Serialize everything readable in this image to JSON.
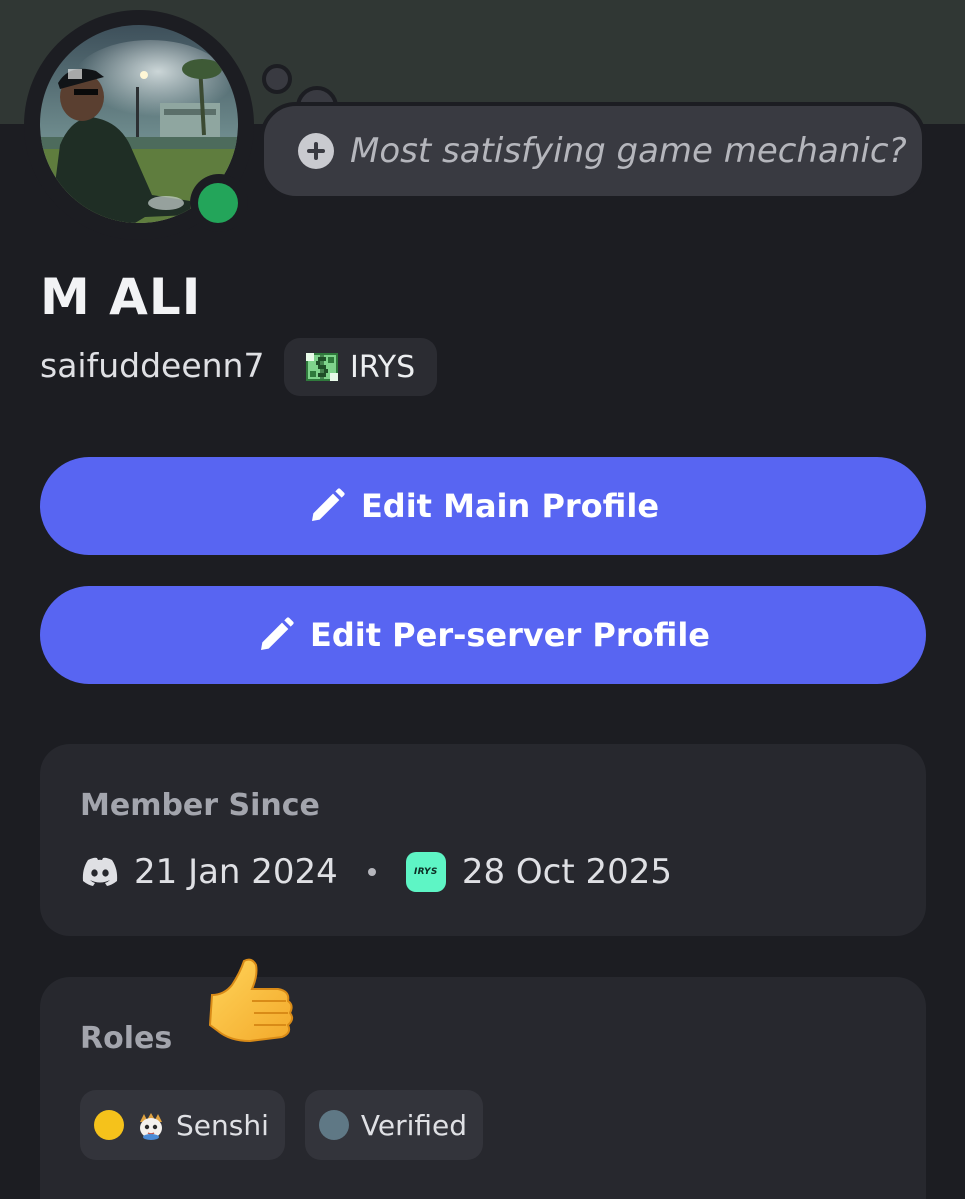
{
  "profile": {
    "display_name": "M ALI",
    "username": "saifuddeenn7",
    "server_tag": "IRYS",
    "status_prompt": "Most satisfying game mechanic?",
    "status_color": "#23a55a",
    "banner_color": "#303734"
  },
  "actions": {
    "edit_main": "Edit Main Profile",
    "edit_server": "Edit Per-server Profile",
    "accent_color": "#5865f2"
  },
  "member_since": {
    "title": "Member Since",
    "discord_date": "21 Jan 2024",
    "server_date": "28 Oct 2025",
    "server_icon_text": "IRYS"
  },
  "roles": {
    "title": "Roles",
    "items": [
      {
        "label": "Senshi",
        "color": "#f5c21b",
        "icon": "anime-character-icon"
      },
      {
        "label": "Verified",
        "color": "#5f7885"
      }
    ]
  }
}
